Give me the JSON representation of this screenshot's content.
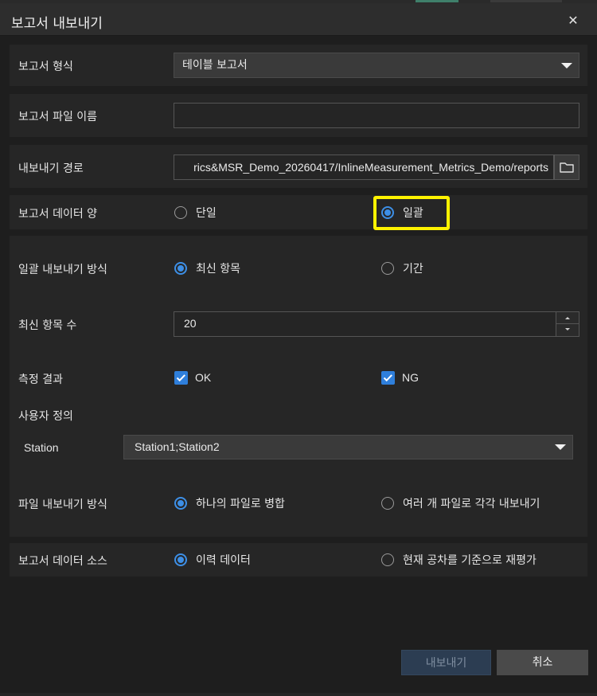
{
  "dialog": {
    "title": "보고서 내보내기"
  },
  "report_format": {
    "label": "보고서 형식",
    "value": "테이블 보고서"
  },
  "file_name": {
    "label": "보고서 파일 이름",
    "value": ""
  },
  "export_path": {
    "label": "내보내기 경로",
    "value": "rics&MSR_Demo_20260417/InlineMeasurement_Metrics_Demo/reports"
  },
  "data_amount": {
    "label": "보고서 데이터 양",
    "options": [
      "단일",
      "일괄"
    ],
    "selected": "일괄"
  },
  "batch_mode": {
    "label": "일괄 내보내기 방식",
    "options": [
      "최신 항목",
      "기간"
    ],
    "selected": "최신 항목"
  },
  "latest_count": {
    "label": "최신 항목 수",
    "value": "20"
  },
  "measurement_result": {
    "label": "측정 결과",
    "options": [
      {
        "label": "OK",
        "checked": true
      },
      {
        "label": "NG",
        "checked": true
      }
    ]
  },
  "custom": {
    "label": "사용자 정의",
    "station_label": "Station",
    "station_value": "Station1;Station2"
  },
  "file_mode": {
    "label": "파일 내보내기 방식",
    "options": [
      "하나의 파일로 병합",
      "여러 개 파일로 각각 내보내기"
    ],
    "selected": "하나의 파일로 병합"
  },
  "data_source": {
    "label": "보고서 데이터 소스",
    "options": [
      "이력 데이터",
      "현재 공차를 기준으로 재평가"
    ],
    "selected": "이력 데이터"
  },
  "buttons": {
    "export": "내보내기",
    "cancel": "취소"
  },
  "colors": {
    "accent": "#3d8fe6",
    "highlight": "#fff200",
    "background": "#1e1e1e"
  }
}
